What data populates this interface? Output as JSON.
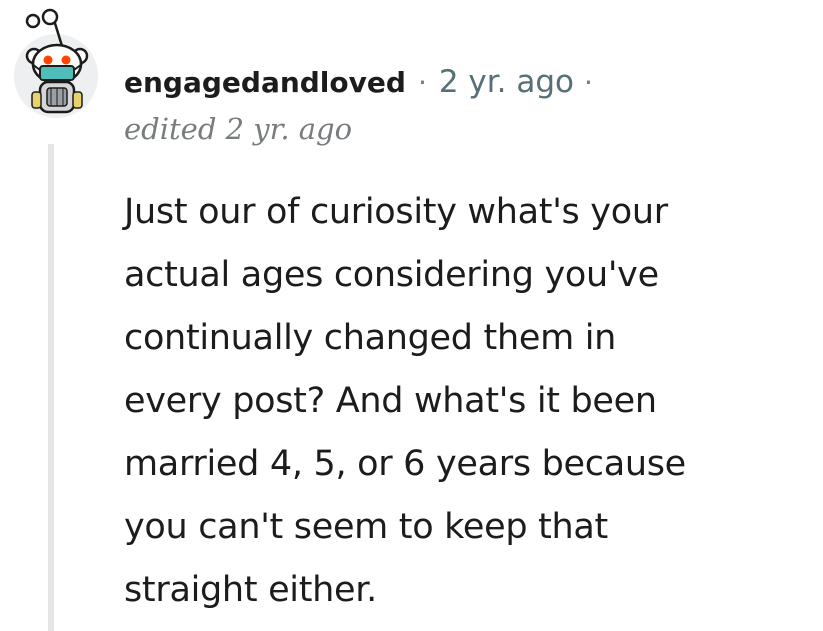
{
  "comment": {
    "author": "engagedandloved",
    "separator": "·",
    "timestamp": "2 yr. ago",
    "trailing_separator": "·",
    "edited": "edited 2 yr. ago",
    "body_lines": [
      "Just our of curiosity what's your",
      "actual ages considering you've",
      "continually changed them in",
      "every post? And what's it been",
      "married 4, 5, or 6 years because",
      "you can't seem to keep that",
      "straight either."
    ]
  },
  "colors": {
    "text": "#1c1c1c",
    "meta": "#576f76",
    "thread_line": "#e6e6e6",
    "avatar_bg": "#edeff1",
    "mask": "#4fbdba"
  },
  "icons": {
    "avatar": "snoo-avatar-with-mask-icon"
  }
}
